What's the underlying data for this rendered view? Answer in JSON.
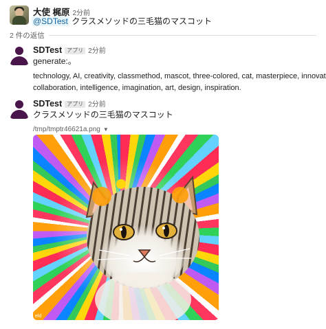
{
  "top_message": {
    "author": "大使 梶原",
    "time": "2分前",
    "mention": "@SDTest",
    "text": "クラスメソッドの三毛猫のマスコット"
  },
  "replies": {
    "count_label": "2 件の返信"
  },
  "reply1": {
    "author": "SDTest",
    "badge": "アプリ",
    "time": "2分前",
    "line1": "generate:。",
    "line2": "technology, AI, creativity, classmethod, mascot, three-colored, cat, masterpiece, innovation,",
    "line3": "collaboration, intelligence, imagination, art, design, inspiration."
  },
  "reply2": {
    "author": "SDTest",
    "badge": "アプリ",
    "time": "2分前",
    "text": "クラスメソッドの三毛猫のマスコット",
    "file_name": "/tmp/tmptr46621a.png",
    "image_alt": "colorful cat mascot illustration"
  },
  "colors": {
    "link": "#1264a3",
    "mention_bg": "#e8f5fa",
    "app_avatar": "#4a154b"
  }
}
